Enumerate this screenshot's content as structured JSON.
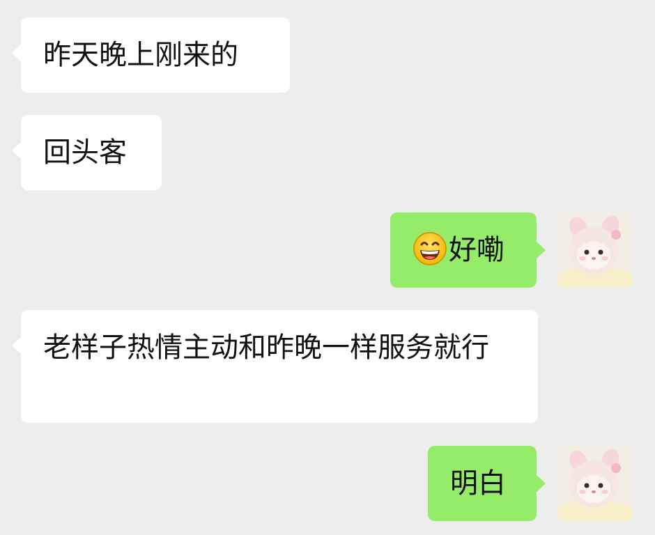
{
  "messages": [
    {
      "side": "left",
      "text": "昨天晚上刚来的"
    },
    {
      "side": "left",
      "text": "回头客"
    },
    {
      "side": "right",
      "emoji": "grinning-face-icon",
      "text": "好嘞"
    },
    {
      "side": "left",
      "text": "老样子热情主动和昨晚一样服务就行"
    },
    {
      "side": "right",
      "text": "明白"
    }
  ],
  "colors": {
    "background": "#ededed",
    "incoming_bubble": "#ffffff",
    "outgoing_bubble": "#95ec69",
    "text": "#111111"
  },
  "avatar": {
    "icon": "plush-bunny-avatar-icon"
  }
}
